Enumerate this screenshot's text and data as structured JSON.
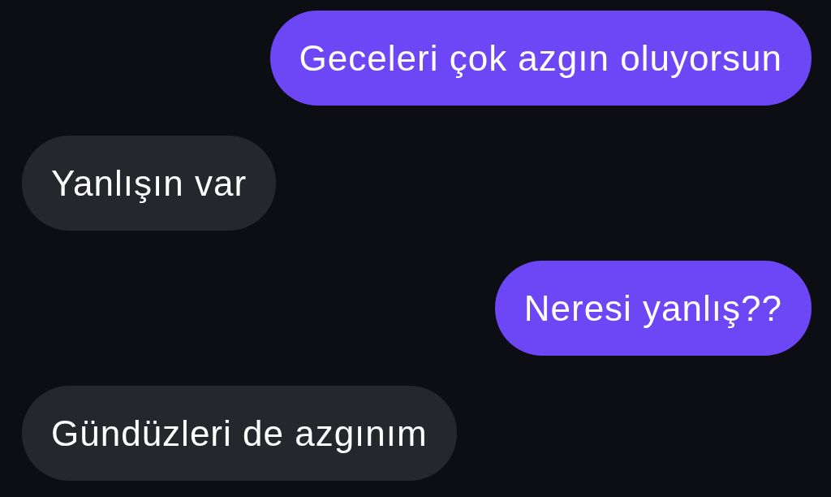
{
  "messages": [
    {
      "kind": "sent",
      "text": "Geceleri çok azgın oluyorsun"
    },
    {
      "kind": "received",
      "text": "Yanlışın var"
    },
    {
      "kind": "sent",
      "text": "Neresi yanlış??"
    },
    {
      "kind": "received",
      "text": "Gündüzleri de azgınım"
    }
  ]
}
